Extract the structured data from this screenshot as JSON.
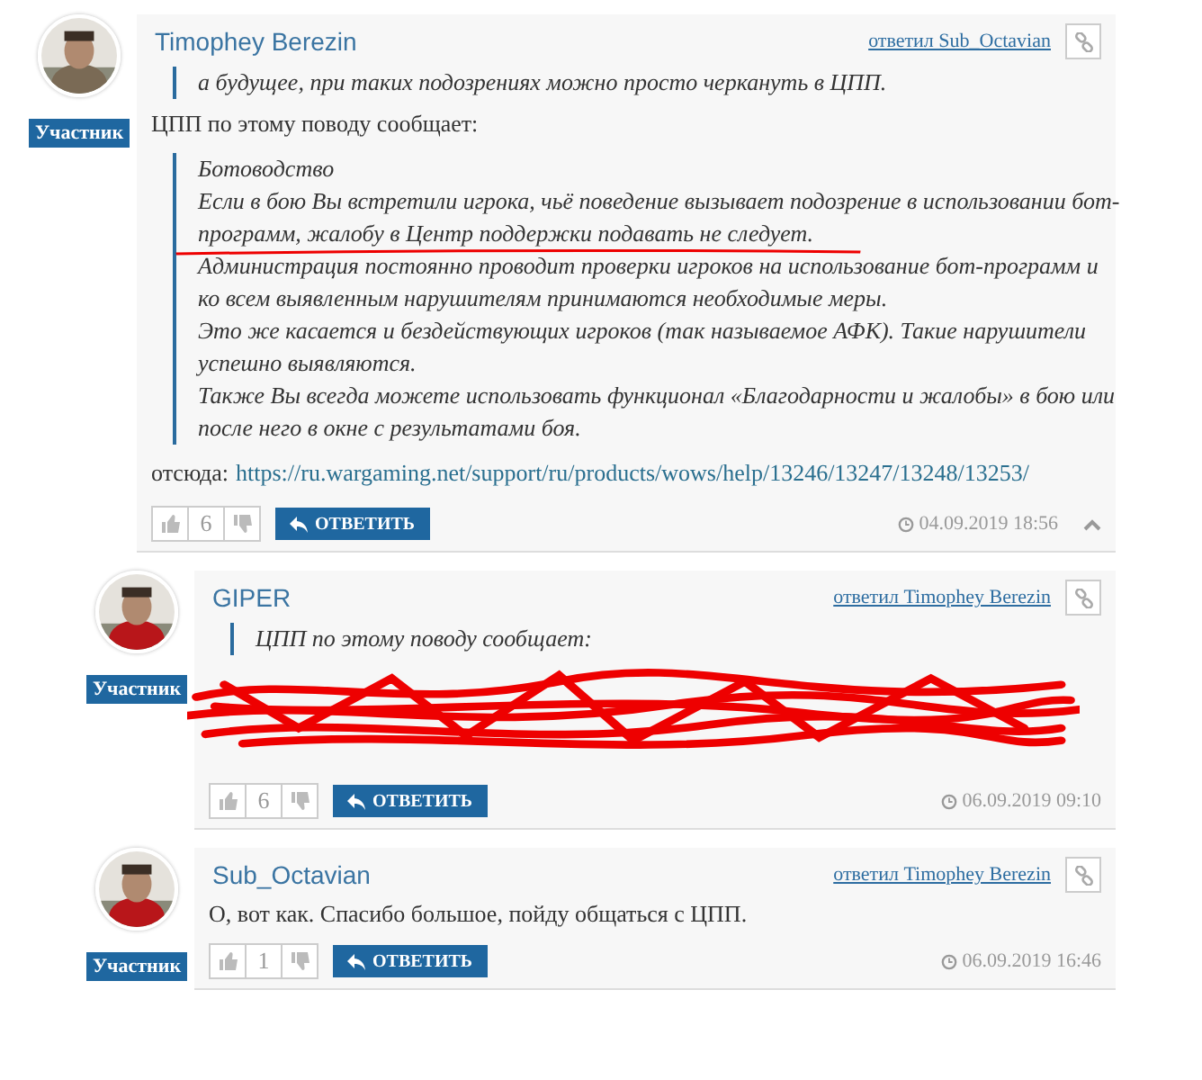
{
  "comments": [
    {
      "author": "Timophey Berezin",
      "role": "Участник",
      "reply_to": "ответил Sub_Octavian",
      "avatar": {
        "kind": "picture"
      },
      "body": [
        {
          "kind": "quote",
          "lines": [
            {
              "text": "а будущее, при таких подозрениях можно просто черкануть в ЦПП.",
              "scribbled_underline": false
            }
          ]
        },
        {
          "kind": "text",
          "text": "ЦПП по этому поводу сообщает:"
        },
        {
          "kind": "quote",
          "lines": [
            {
              "text": "Ботоводство",
              "scribbled_underline": false
            },
            {
              "text": "Если в бою Вы встретили игрока, чьё поведение вызывает подозрение в использовании бот-",
              "scribbled_underline": false
            },
            {
              "text": "программ, жалобу в Центр поддержки подавать не следует.",
              "scribbled_underline": true
            },
            {
              "text": "Администрация постоянно проводит проверки игроков на использование бот-программ и",
              "scribbled_underline": false
            },
            {
              "text": "ко всем выявленным нарушителям принимаются необходимые меры.",
              "scribbled_underline": false
            },
            {
              "text": "Это же касается и бездействующих игроков (так называемое АФК). Такие нарушители",
              "scribbled_underline": false
            },
            {
              "text": "успешно выявляются.",
              "scribbled_underline": false
            },
            {
              "text": "Также Вы всегда можете использовать функционал «Благодарности и жалобы» в бою или",
              "scribbled_underline": false
            },
            {
              "text": "после него в окне с результатами боя.",
              "scribbled_underline": false
            }
          ]
        },
        {
          "kind": "link",
          "label": "отсюда:",
          "url": "https://ru.wargaming.net/support/ru/products/wows/help/13246/13247/13248/13253/"
        }
      ],
      "likes": "6",
      "reply_button": "ОТВЕТИТЬ",
      "time": "04.09.2019 18:56",
      "collapsible": true,
      "children": [
        {
          "author": "GIPER",
          "role": "Участник",
          "reply_to": "ответил Timophey Berezin",
          "avatar": {
            "kind": "picture"
          },
          "body": [
            {
              "kind": "quote",
              "lines": [
                {
                  "text": "ЦПП по этому поводу сообщает:",
                  "scribbled_underline": false
                }
              ]
            },
            {
              "kind": "redacted"
            }
          ],
          "likes": "6",
          "reply_button": "ОТВЕТИТЬ",
          "time": "06.09.2019 09:10",
          "collapsible": false
        },
        {
          "author": "Sub_Octavian",
          "role": "Участник",
          "reply_to": "ответил Timophey Berezin",
          "avatar": {
            "kind": "picture"
          },
          "body": [
            {
              "kind": "text",
              "text": "О, вот как. Спасибо большое, пойду общаться с ЦПП."
            }
          ],
          "likes": "1",
          "reply_button": "ОТВЕТИТЬ",
          "time": "06.09.2019 16:46",
          "collapsible": false
        }
      ]
    }
  ]
}
